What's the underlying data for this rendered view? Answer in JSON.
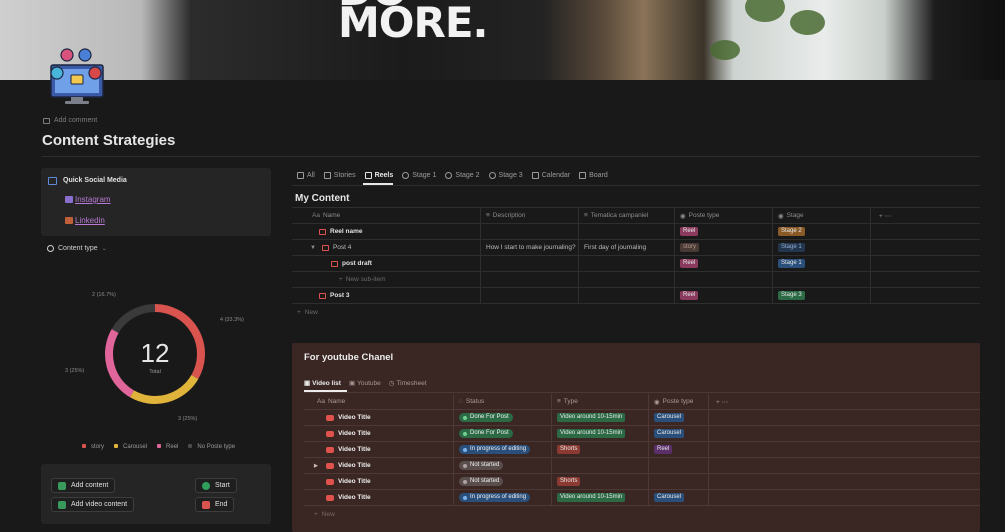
{
  "cover": {
    "text_top": "DO",
    "text_main": "MORE."
  },
  "page": {
    "add_comment": "Add comment",
    "title": "Content Strategies"
  },
  "quick_social": {
    "title": "Quick Social Media",
    "links": [
      {
        "label": "Instagram",
        "icon": "camera-icon"
      },
      {
        "label": "Linkedin",
        "icon": "briefcase-icon"
      }
    ]
  },
  "content_type": {
    "label": "Content type"
  },
  "chart_data": {
    "type": "pie",
    "total": 12,
    "total_label": "Total",
    "slices": [
      {
        "name": "story",
        "value": 3,
        "label": "3 (25%)",
        "color": "#e0659a"
      },
      {
        "name": "Carousel",
        "value": 3,
        "label": "3 (25%)",
        "color": "#e0b33a"
      },
      {
        "name": "Reel",
        "value": 4,
        "label": "4 (33.3%)",
        "color": "#d9534f"
      },
      {
        "name": "No Poste type",
        "value": 2,
        "label": "2 (16.7%)",
        "color": "#3a3a3a"
      }
    ],
    "legend": [
      "story",
      "Carousel",
      "Reel",
      "No Poste type"
    ]
  },
  "buttons": {
    "add_content": "Add content",
    "add_video_content": "Add video content",
    "start": "Start",
    "end": "End"
  },
  "tabs": [
    "All",
    "Stories",
    "Reels",
    "Stage 1",
    "Stage 2",
    "Stage 3",
    "Calendar",
    "Board"
  ],
  "my_content": {
    "title": "My Content",
    "columns": [
      "Name",
      "Description",
      "Tematica campaniel",
      "Poste type",
      "Stage"
    ],
    "rows": [
      {
        "name": "Reel name",
        "description": "",
        "tematica": "",
        "poste_type": "Reel",
        "stage": "Stage 2"
      },
      {
        "name": "Post 4",
        "description": "How I start to make journaling?",
        "tematica": "First day of journaling",
        "poste_type": "story",
        "stage": "Stage 1"
      },
      {
        "name": "post draft",
        "description": "",
        "tematica": "",
        "poste_type": "Reel",
        "stage": "Stage 1"
      },
      {
        "name": "Post 3",
        "description": "",
        "tematica": "",
        "poste_type": "Reel",
        "stage": "Stage 3"
      }
    ],
    "new_sub_item": "New sub-item",
    "new": "New"
  },
  "youtube": {
    "title": "For youtube Chanel",
    "tabs": [
      "Video list",
      "Youtube",
      "Timesheet"
    ],
    "columns": [
      "Name",
      "Status",
      "Type",
      "Poste type"
    ],
    "rows": [
      {
        "name": "Video Title",
        "status": "Done For Post",
        "type": "Video around 10-15min",
        "poste_type": "Carousel"
      },
      {
        "name": "Video Title",
        "status": "Done For Post",
        "type": "Video around 10-15min",
        "poste_type": "Carousel"
      },
      {
        "name": "Video Title",
        "status": "In progress of editing",
        "type": "Shorts",
        "poste_type": "Reel"
      },
      {
        "name": "Video Title",
        "status": "Not started",
        "type": "",
        "poste_type": ""
      },
      {
        "name": "Video Title",
        "status": "Not started",
        "type": "Shorts",
        "poste_type": ""
      },
      {
        "name": "Video Title",
        "status": "In progress of editing",
        "type": "Video around 10-15min",
        "poste_type": "Carousel"
      }
    ],
    "new": "New"
  }
}
